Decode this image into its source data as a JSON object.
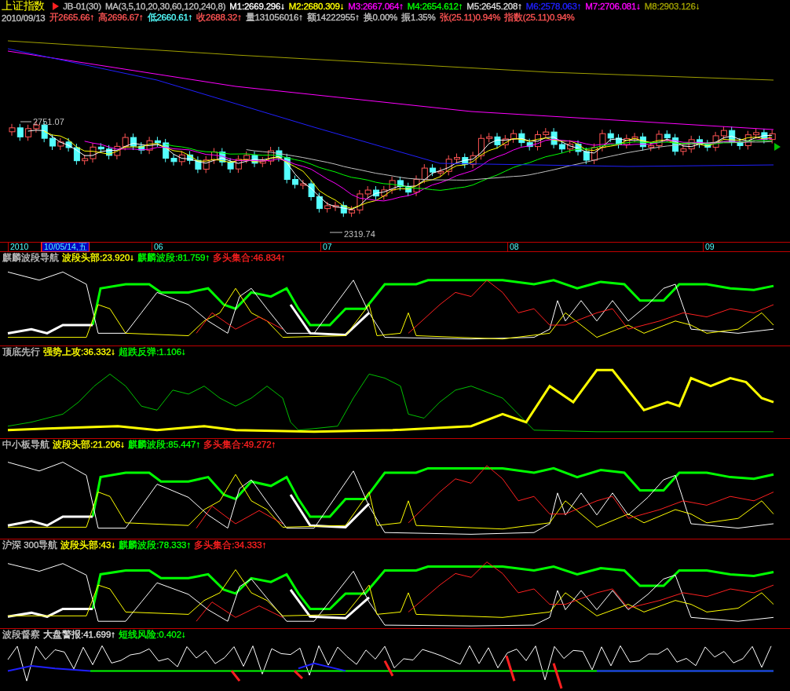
{
  "header": {
    "title": "上证指数",
    "formula": "JB-01(30)",
    "ma_params": "MA(3,5,10,20,30,60,120,240,8)",
    "ma_values": [
      {
        "text": "M1:2669.296↓",
        "color": "#ffffff"
      },
      {
        "text": "M2:2680.309↓",
        "color": "#ffff00"
      },
      {
        "text": "M3:2667.064↑",
        "color": "#ff00ff"
      },
      {
        "text": "M4:2654.612↑",
        "color": "#00ff00"
      },
      {
        "text": "M5:2645.208↑",
        "color": "#dcdcdc"
      },
      {
        "text": "M6:2578.063↑",
        "color": "#2020ff"
      },
      {
        "text": "M7:2706.081↓",
        "color": "#ff00ff"
      },
      {
        "text": "M8:2903.126↓",
        "color": "#a0a000"
      }
    ]
  },
  "quote": {
    "date": "2010/09/13",
    "items": [
      {
        "text": "开2665.66↑",
        "color": "#ff5454"
      },
      {
        "text": "高2696.67↑",
        "color": "#ff5454"
      },
      {
        "text": "低2660.61↑",
        "color": "#54ffff"
      },
      {
        "text": "收2688.32↑",
        "color": "#ff5454"
      },
      {
        "text": "量131056016↑",
        "color": "#c0c0c0"
      },
      {
        "text": "额14222955↑",
        "color": "#c0c0c0"
      },
      {
        "text": "换0.00%",
        "color": "#c0c0c0"
      },
      {
        "text": "振1.35%",
        "color": "#c0c0c0"
      },
      {
        "text": "张(25.11)0.94%",
        "color": "#ff5454"
      },
      {
        "text": "指数(25.11)0.94%",
        "color": "#ff5454"
      }
    ]
  },
  "price_chart": {
    "high_label": "2751.07",
    "low_label": "2319.74"
  },
  "axis": {
    "labels": [
      {
        "text": "2010",
        "selected": false
      },
      {
        "text": "10/05/14,五",
        "selected": true
      },
      {
        "text": "06",
        "selected": false
      },
      {
        "text": "07",
        "selected": false
      },
      {
        "text": "08",
        "selected": false
      },
      {
        "text": "09",
        "selected": false
      }
    ]
  },
  "panes": [
    {
      "kind": "wave",
      "title": "麒麟波段导航",
      "indicators": [
        {
          "text": "波段头部:23.920↓",
          "color": "#ffff00"
        },
        {
          "text": "麒麟波段:81.759↑",
          "color": "#00ff00"
        },
        {
          "text": "多头集合:46.834↑",
          "color": "#ff2020"
        }
      ]
    },
    {
      "kind": "lead",
      "title": "顶底先行",
      "indicators": [
        {
          "text": "强势上攻:36.332↓",
          "color": "#ffff00"
        },
        {
          "text": "超跌反弹:1.106↓",
          "color": "#00ff00"
        }
      ]
    },
    {
      "kind": "wave",
      "title": "中小板导航",
      "indicators": [
        {
          "text": "波段头部:21.206↓",
          "color": "#ffff00"
        },
        {
          "text": "麒麟波段:85.447↑",
          "color": "#00ff00"
        },
        {
          "text": "多头集合:49.272↑",
          "color": "#ff2020"
        }
      ]
    },
    {
      "kind": "wave",
      "title": "沪深 300导航",
      "indicators": [
        {
          "text": "波段头部:43↓",
          "color": "#ffff00"
        },
        {
          "text": "麒麟波段:78.333↑",
          "color": "#00ff00"
        },
        {
          "text": "多头集合:34.333↑",
          "color": "#ff2020"
        }
      ]
    },
    {
      "kind": "alert",
      "title": "波段督察",
      "indicators": [
        {
          "text": "大盘警报:41.699↑",
          "color": "#e0e0e0"
        },
        {
          "text": "短线风险:0.402↓",
          "color": "#00ff00"
        }
      ]
    }
  ]
}
